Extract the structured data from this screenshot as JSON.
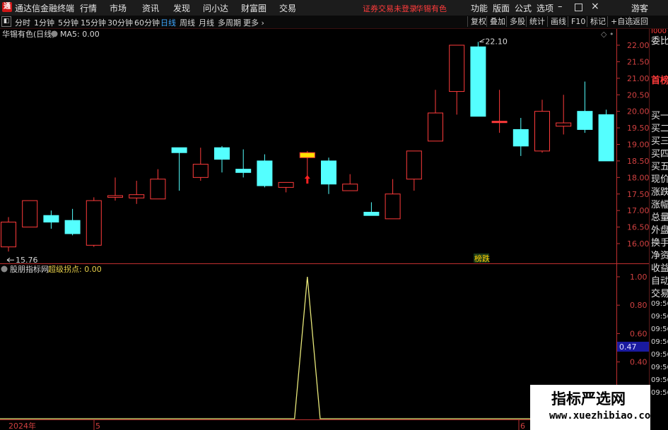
{
  "titlebar": {
    "app_title": "通达信金融终端",
    "menus": [
      "行情",
      "市场",
      "资讯",
      "发现",
      "问小达",
      "财富圈",
      "交易"
    ],
    "warning": "证券交易未登录",
    "stock": "华锡有色",
    "right_menus": [
      "功能",
      "版面",
      "公式",
      "选项"
    ],
    "guest": "游客",
    "logo_char": "通"
  },
  "toolbar": {
    "periods": [
      "分时",
      "1分钟",
      "5分钟",
      "15分钟",
      "30分钟",
      "60分钟",
      "日线",
      "周线",
      "月线",
      "多周期",
      "更多"
    ],
    "active_period": "日线",
    "right_buttons": [
      "复权",
      "叠加",
      "多股",
      "统计",
      "画线",
      "F10",
      "标记",
      "+自选",
      "返回"
    ]
  },
  "main_chart": {
    "stock_label": "华锡有色(日线)",
    "ma_label": "MA5: 0.00",
    "max_label": "22.10",
    "min_label": "15.76",
    "marker_text": "榜跌"
  },
  "indicator": {
    "name": "股朋指标网",
    "value_label": "超级拐点: 0.00",
    "current_value": "0.47"
  },
  "x_axis": {
    "labels": [
      "2024年",
      "5",
      "6"
    ]
  },
  "right_panel": {
    "top_mark": "I000",
    "items": [
      "委比",
      "首榜",
      "买一",
      "买二",
      "买三",
      "买四",
      "买五",
      "现价",
      "涨跌",
      "涨幅",
      "总量",
      "外盘",
      "换手",
      "净资",
      "收益"
    ],
    "auto_trade": [
      "自动",
      "交易"
    ],
    "times": [
      "09:56",
      "09:56",
      "09:56",
      "09:56",
      "09:56",
      "09:56",
      "09:56",
      "09:56"
    ]
  },
  "watermark": {
    "line1": "指标严选网",
    "line2": "www.xuezhibiao.com"
  },
  "colors": {
    "up": "#ff3b3b",
    "down": "#54ffff",
    "axis": "#c03030",
    "active": "#3ea6ff",
    "indicator_line": "#e8e87a"
  },
  "chart_data": [
    {
      "type": "candlestick",
      "title": "华锡有色(日线)",
      "ylim": [
        15.6,
        22.5
      ],
      "y_ticks": [
        16.0,
        16.5,
        17.0,
        17.5,
        18.0,
        18.5,
        19.0,
        19.5,
        20.0,
        20.5,
        21.0,
        21.5,
        22.0
      ],
      "candles": [
        {
          "o": 15.9,
          "c": 16.65,
          "h": 16.8,
          "l": 15.76,
          "dir": "up"
        },
        {
          "o": 16.5,
          "c": 17.3,
          "h": 17.3,
          "l": 16.5,
          "dir": "up"
        },
        {
          "o": 16.85,
          "c": 16.65,
          "h": 17.0,
          "l": 16.45,
          "dir": "down"
        },
        {
          "o": 16.7,
          "c": 16.3,
          "h": 17.05,
          "l": 16.25,
          "dir": "down"
        },
        {
          "o": 15.95,
          "c": 17.3,
          "h": 17.4,
          "l": 15.9,
          "dir": "up"
        },
        {
          "o": 17.4,
          "c": 17.45,
          "h": 18.0,
          "l": 17.3,
          "dir": "up"
        },
        {
          "o": 17.38,
          "c": 17.48,
          "h": 17.9,
          "l": 17.2,
          "dir": "up"
        },
        {
          "o": 17.35,
          "c": 17.95,
          "h": 18.25,
          "l": 17.35,
          "dir": "up"
        },
        {
          "o": 18.9,
          "c": 18.75,
          "h": 18.9,
          "l": 17.6,
          "dir": "down"
        },
        {
          "o": 18.0,
          "c": 18.4,
          "h": 18.9,
          "l": 17.9,
          "dir": "up"
        },
        {
          "o": 18.9,
          "c": 18.55,
          "h": 18.95,
          "l": 18.15,
          "dir": "down"
        },
        {
          "o": 18.25,
          "c": 18.15,
          "h": 18.85,
          "l": 18.0,
          "dir": "down"
        },
        {
          "o": 18.5,
          "c": 17.75,
          "h": 18.7,
          "l": 17.7,
          "dir": "down"
        },
        {
          "o": 17.7,
          "c": 17.85,
          "h": 17.85,
          "l": 17.55,
          "dir": "up"
        },
        {
          "o": 18.6,
          "c": 18.75,
          "h": 18.8,
          "l": 17.95,
          "dir": "highlight"
        },
        {
          "o": 18.5,
          "c": 17.8,
          "h": 18.6,
          "l": 17.5,
          "dir": "down"
        },
        {
          "o": 17.6,
          "c": 17.8,
          "h": 18.1,
          "l": 17.6,
          "dir": "up"
        },
        {
          "o": 16.95,
          "c": 16.85,
          "h": 17.25,
          "l": 16.85,
          "dir": "down"
        },
        {
          "o": 16.75,
          "c": 17.5,
          "h": 17.95,
          "l": 16.75,
          "dir": "up"
        },
        {
          "o": 17.95,
          "c": 18.8,
          "h": 18.8,
          "l": 17.6,
          "dir": "up"
        },
        {
          "o": 19.1,
          "c": 19.95,
          "h": 20.65,
          "l": 19.1,
          "dir": "up"
        },
        {
          "o": 20.6,
          "c": 22.0,
          "h": 22.0,
          "l": 19.9,
          "dir": "up"
        },
        {
          "o": 21.95,
          "c": 19.85,
          "h": 22.1,
          "l": 19.85,
          "dir": "down"
        },
        {
          "o": 19.7,
          "c": 19.7,
          "h": 20.65,
          "l": 19.35,
          "dir": "flat"
        },
        {
          "o": 19.45,
          "c": 18.95,
          "h": 19.8,
          "l": 18.65,
          "dir": "down"
        },
        {
          "o": 18.8,
          "c": 20.0,
          "h": 20.35,
          "l": 18.75,
          "dir": "up"
        },
        {
          "o": 19.55,
          "c": 19.65,
          "h": 20.5,
          "l": 19.3,
          "dir": "up"
        },
        {
          "o": 20.0,
          "c": 19.45,
          "h": 20.9,
          "l": 19.35,
          "dir": "down"
        },
        {
          "o": 19.9,
          "c": 18.5,
          "h": 20.05,
          "l": 18.5,
          "dir": "down"
        }
      ]
    },
    {
      "type": "line",
      "title": "超级拐点",
      "ylim": [
        0,
        1.0
      ],
      "y_ticks": [
        0.0,
        0.2,
        0.4,
        0.6,
        0.8,
        1.0
      ],
      "x": [
        0,
        13.4,
        14,
        14.6,
        29
      ],
      "values": [
        0,
        0,
        1.0,
        0,
        0
      ]
    }
  ]
}
